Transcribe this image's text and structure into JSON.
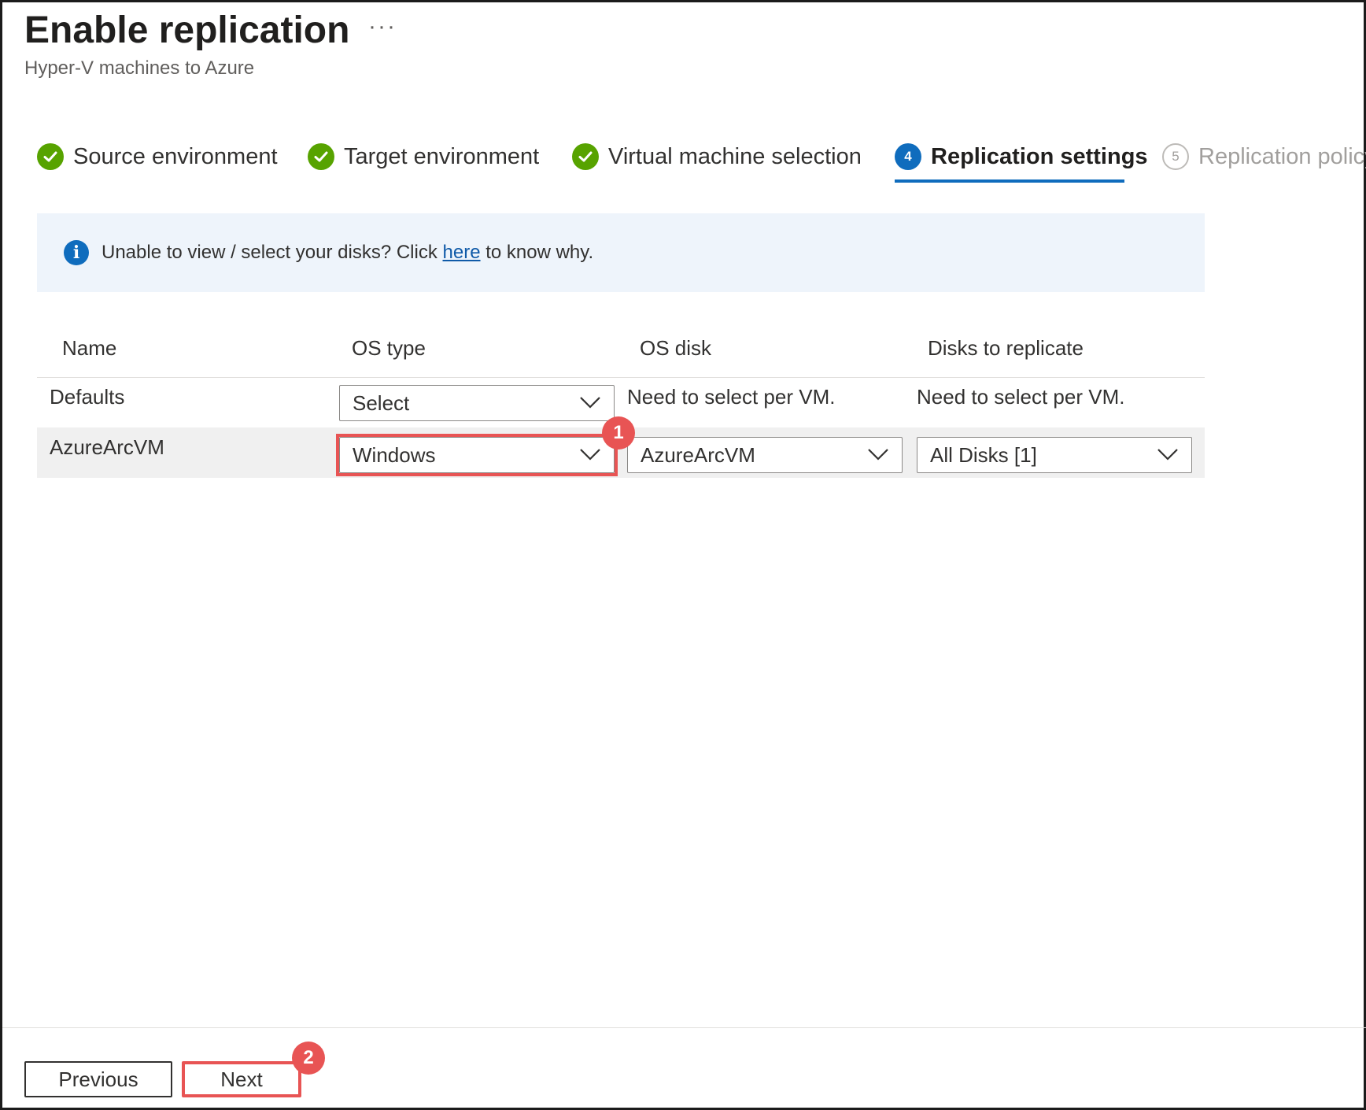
{
  "header": {
    "title": "Enable replication",
    "more_label": "···",
    "subtitle": "Hyper-V machines to Azure"
  },
  "steps": [
    {
      "label": "Source environment",
      "state": "completed"
    },
    {
      "label": "Target environment",
      "state": "completed"
    },
    {
      "label": "Virtual machine selection",
      "state": "completed"
    },
    {
      "label": "Replication settings",
      "state": "active",
      "number": "4"
    },
    {
      "label": "Replication policy",
      "state": "disabled",
      "number": "5"
    }
  ],
  "info_bar": {
    "icon": "info-icon",
    "text_before": "Unable to view / select your disks? Click ",
    "link_text": "here",
    "text_after": " to know why."
  },
  "table": {
    "headers": [
      "Name",
      "OS type",
      "OS disk",
      "Disks to replicate"
    ],
    "defaults_row": {
      "name": "Defaults",
      "os_type": "Select",
      "os_disk": "Need to select per VM.",
      "disks": "Need to select per VM."
    },
    "vm_row": {
      "name": "AzureArcVM",
      "os_type": "Windows",
      "os_disk": "AzureArcVM",
      "disks": "All Disks [1]"
    }
  },
  "callouts": {
    "one": "1",
    "two": "2"
  },
  "footer": {
    "previous_label": "Previous",
    "next_label": "Next"
  },
  "colors": {
    "accent": "#0f6cbd",
    "success": "#57a300",
    "highlight": "#e85454",
    "info_background": "#eef4fb",
    "row_highlight": "#f0f0f0"
  }
}
